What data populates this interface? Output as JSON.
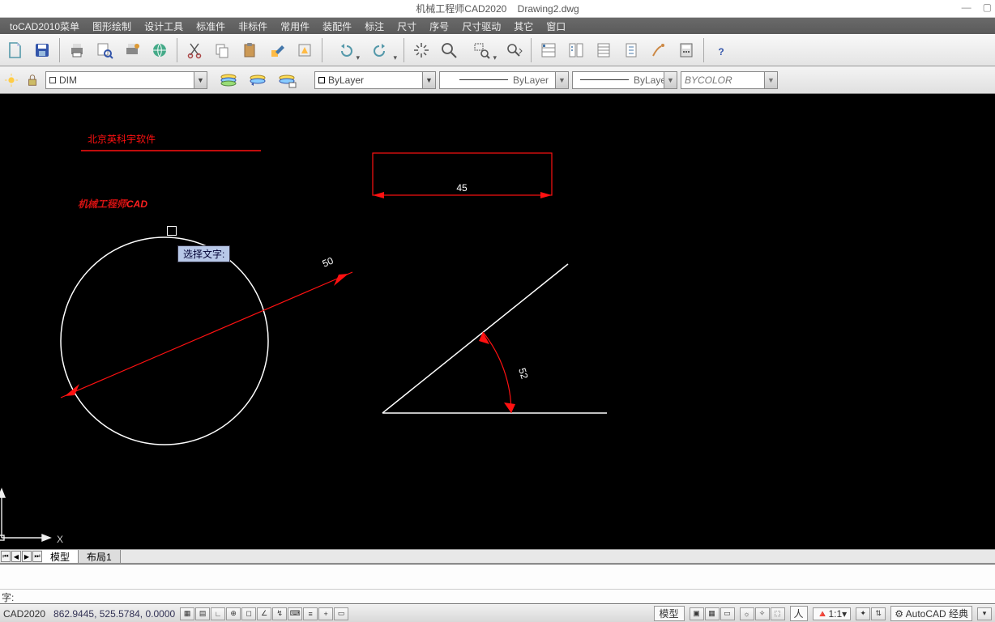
{
  "title": {
    "app": "机械工程师CAD2020",
    "doc": "Drawing2.dwg"
  },
  "menu": [
    "toCAD2010菜单",
    "图形绘制",
    "设计工具",
    "标准件",
    "非标件",
    "常用件",
    "装配件",
    "标注",
    "尺寸",
    "序号",
    "尺寸驱动",
    "其它",
    "窗口"
  ],
  "layer": {
    "current": "DIM"
  },
  "props": {
    "color": "ByLayer",
    "ltype": "ByLayer",
    "lweight": "ByLayer",
    "pstyle": "BYCOLOR"
  },
  "tooltip": "选择文字:",
  "drawing": {
    "text_red": "北京英科宇软件",
    "text_oblique": "机械工程师CAD",
    "dim_horiz": "45",
    "dim_diag": "50",
    "dim_angle": "52",
    "ucs_x": "X"
  },
  "doctabs": {
    "model": "模型",
    "layout1": "布局1"
  },
  "cmd": {
    "prompt": "字:"
  },
  "status": {
    "app": "CAD2020",
    "coords": "862.9445, 525.5784, 0.0000",
    "model": "模型",
    "scale": "1:1",
    "workspace": "AutoCAD 经典",
    "human": "人"
  }
}
